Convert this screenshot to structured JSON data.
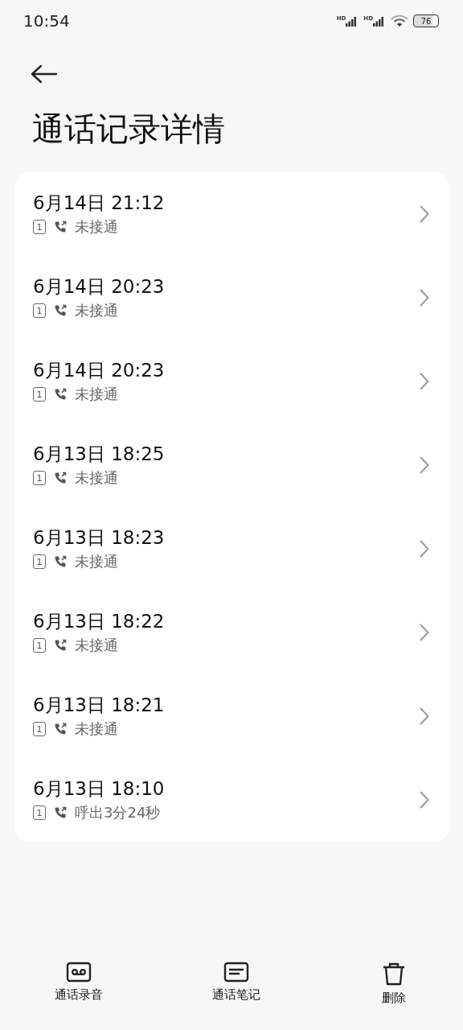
{
  "status_bar": {
    "time": "10:54",
    "network_labels": [
      "HD",
      "HD"
    ],
    "battery": "76"
  },
  "title": "通话记录详情",
  "calls": [
    {
      "time": "6月14日 21:12",
      "sim": "1",
      "status": "未接通"
    },
    {
      "time": "6月14日 20:23",
      "sim": "1",
      "status": "未接通"
    },
    {
      "time": "6月14日 20:23",
      "sim": "1",
      "status": "未接通"
    },
    {
      "time": "6月13日 18:25",
      "sim": "1",
      "status": "未接通"
    },
    {
      "time": "6月13日 18:23",
      "sim": "1",
      "status": "未接通"
    },
    {
      "time": "6月13日 18:22",
      "sim": "1",
      "status": "未接通"
    },
    {
      "time": "6月13日 18:21",
      "sim": "1",
      "status": "未接通"
    },
    {
      "time": "6月13日 18:10",
      "sim": "1",
      "status": "呼出3分24秒"
    }
  ],
  "toolbar": [
    {
      "kind": "recording",
      "label": "通话录音"
    },
    {
      "kind": "notes",
      "label": "通话笔记"
    },
    {
      "kind": "delete",
      "label": "删除"
    }
  ]
}
